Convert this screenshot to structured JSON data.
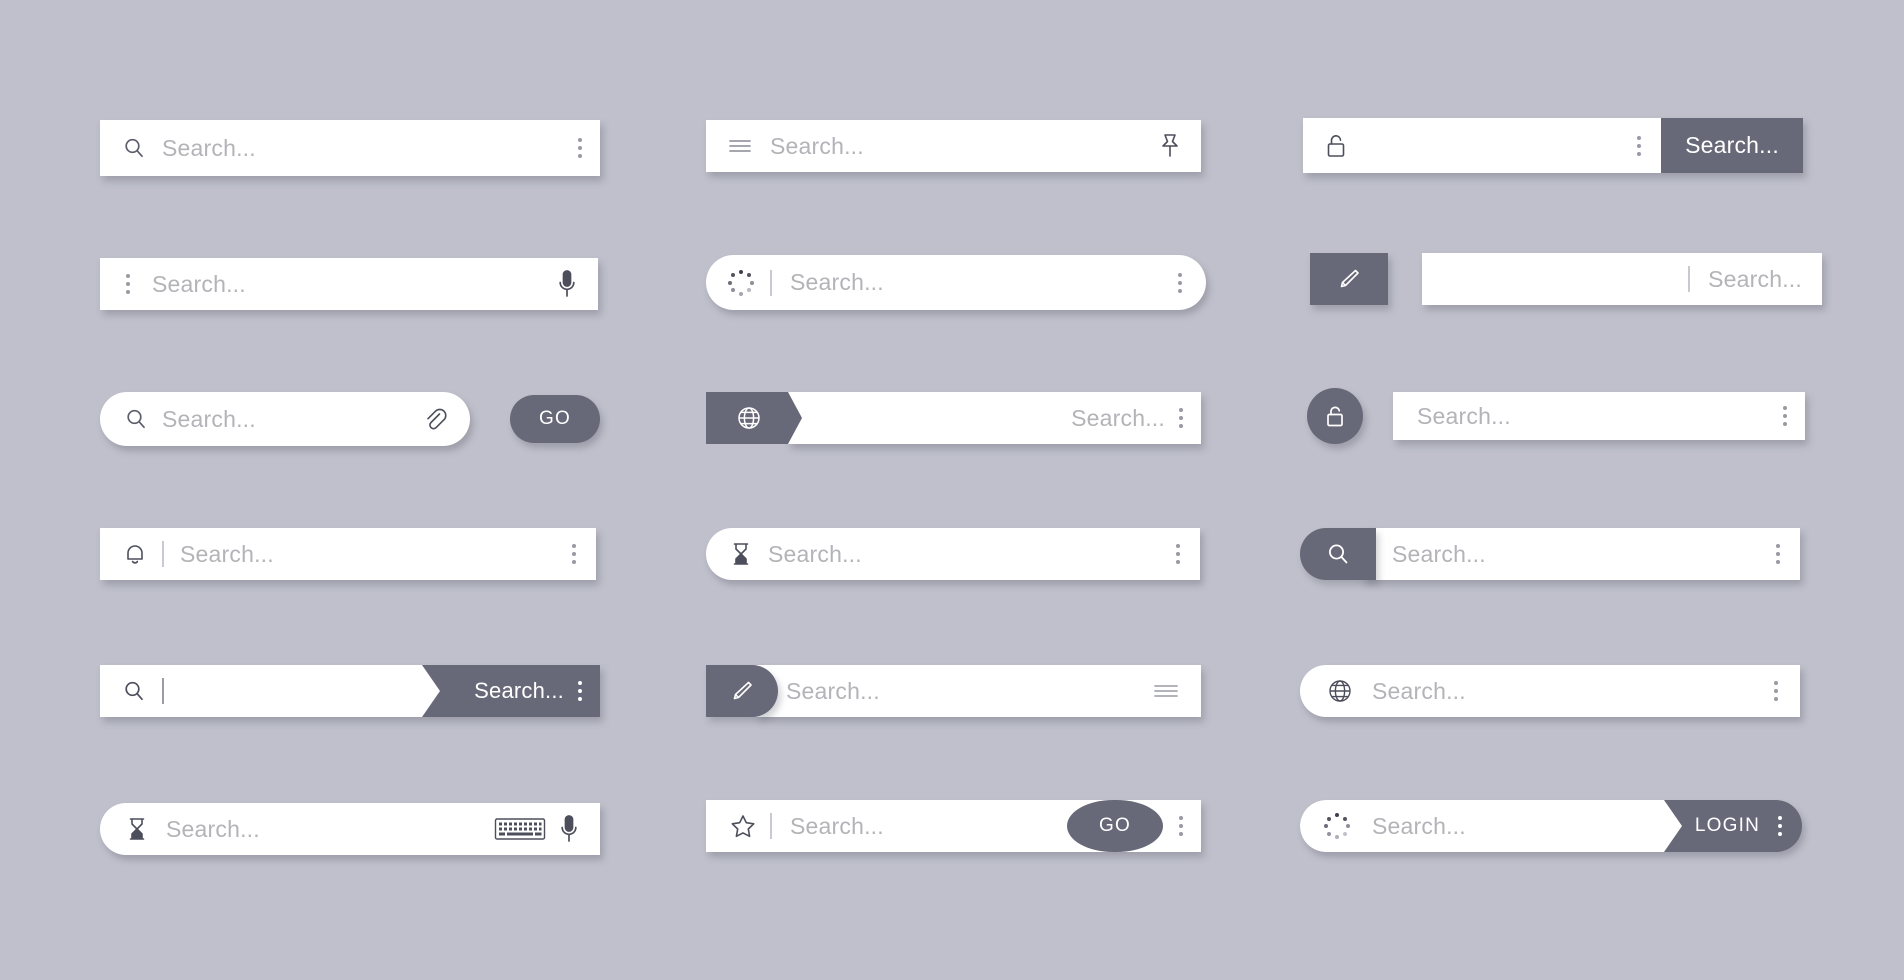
{
  "meta": {
    "background_color": "#bfc0cb",
    "accent_color": "#676878",
    "field_color": "#ffffff",
    "placeholder_color": "#b3b3b8"
  },
  "placeholder": "Search...",
  "labels": {
    "go": "GO",
    "login": "LOGIN",
    "search_button": "Search..."
  },
  "bars": [
    {
      "id": "bar-1",
      "row": 1,
      "col": 1,
      "shape": "rectangle",
      "placeholder": "Search...",
      "left_icon": "magnifier-icon",
      "right_icon": "kebab-menu-icon"
    },
    {
      "id": "bar-2",
      "row": 1,
      "col": 2,
      "shape": "rectangle",
      "placeholder": "Search...",
      "left_icon": "hamburger-menu-icon",
      "right_icon": "pushpin-icon"
    },
    {
      "id": "bar-3",
      "row": 1,
      "col": 3,
      "shape": "rectangle",
      "placeholder": "",
      "left_icon": "padlock-open-icon",
      "right_icon": "kebab-menu-icon",
      "button_label": "Search..."
    },
    {
      "id": "bar-4",
      "row": 2,
      "col": 1,
      "shape": "rectangle",
      "placeholder": "Search...",
      "left_icon": "kebab-menu-icon",
      "right_icon": "microphone-icon"
    },
    {
      "id": "bar-5",
      "row": 2,
      "col": 2,
      "shape": "pill",
      "placeholder": "Search...",
      "left_icon": "loading-spinner-icon",
      "right_icon": "kebab-menu-icon"
    },
    {
      "id": "bar-6",
      "row": 2,
      "col": 3,
      "shape": "rectangle",
      "placeholder": "Search...",
      "left_icon": "pencil-edit-icon",
      "right_icon": ""
    },
    {
      "id": "bar-7",
      "row": 3,
      "col": 1,
      "shape": "pill",
      "placeholder": "Search...",
      "left_icon": "magnifier-icon",
      "right_icon": "paperclip-icon",
      "button_label": "GO"
    },
    {
      "id": "bar-8",
      "row": 3,
      "col": 2,
      "shape": "rectangle",
      "placeholder": "Search...",
      "left_icon": "globe-icon",
      "right_icon": "kebab-menu-icon"
    },
    {
      "id": "bar-9",
      "row": 3,
      "col": 3,
      "shape": "rectangle",
      "placeholder": "Search...",
      "left_icon": "padlock-open-icon",
      "right_icon": "kebab-menu-icon"
    },
    {
      "id": "bar-10",
      "row": 4,
      "col": 1,
      "shape": "rectangle",
      "placeholder": "Search...",
      "left_icon": "bell-icon",
      "right_icon": "kebab-menu-icon"
    },
    {
      "id": "bar-11",
      "row": 4,
      "col": 2,
      "shape": "pill-left",
      "placeholder": "Search...",
      "left_icon": "hourglass-icon",
      "right_icon": "kebab-menu-icon"
    },
    {
      "id": "bar-12",
      "row": 4,
      "col": 3,
      "shape": "rectangle",
      "placeholder": "Search...",
      "left_icon": "magnifier-icon",
      "right_icon": "kebab-menu-icon"
    },
    {
      "id": "bar-13",
      "row": 5,
      "col": 1,
      "shape": "rectangle",
      "placeholder": "",
      "left_icon": "magnifier-icon",
      "right_icon": "kebab-menu-icon",
      "button_label": "Search..."
    },
    {
      "id": "bar-14",
      "row": 5,
      "col": 2,
      "shape": "rectangle",
      "placeholder": "Search...",
      "left_icon": "pencil-edit-icon",
      "right_icon": "hamburger-menu-icon"
    },
    {
      "id": "bar-15",
      "row": 5,
      "col": 3,
      "shape": "pill-left",
      "placeholder": "Search...",
      "left_icon": "globe-icon",
      "right_icon": "kebab-menu-icon"
    },
    {
      "id": "bar-16",
      "row": 6,
      "col": 1,
      "shape": "pill-left",
      "placeholder": "Search...",
      "left_icon": "hourglass-icon",
      "right_icon": "keyboard-icon",
      "right_icon_2": "microphone-icon"
    },
    {
      "id": "bar-17",
      "row": 6,
      "col": 2,
      "shape": "rectangle",
      "placeholder": "Search...",
      "left_icon": "star-icon",
      "right_icon": "kebab-menu-icon",
      "button_label": "GO"
    },
    {
      "id": "bar-18",
      "row": 6,
      "col": 3,
      "shape": "pill",
      "placeholder": "Search...",
      "left_icon": "loading-spinner-icon",
      "right_icon": "kebab-menu-icon",
      "button_label": "LOGIN"
    }
  ]
}
